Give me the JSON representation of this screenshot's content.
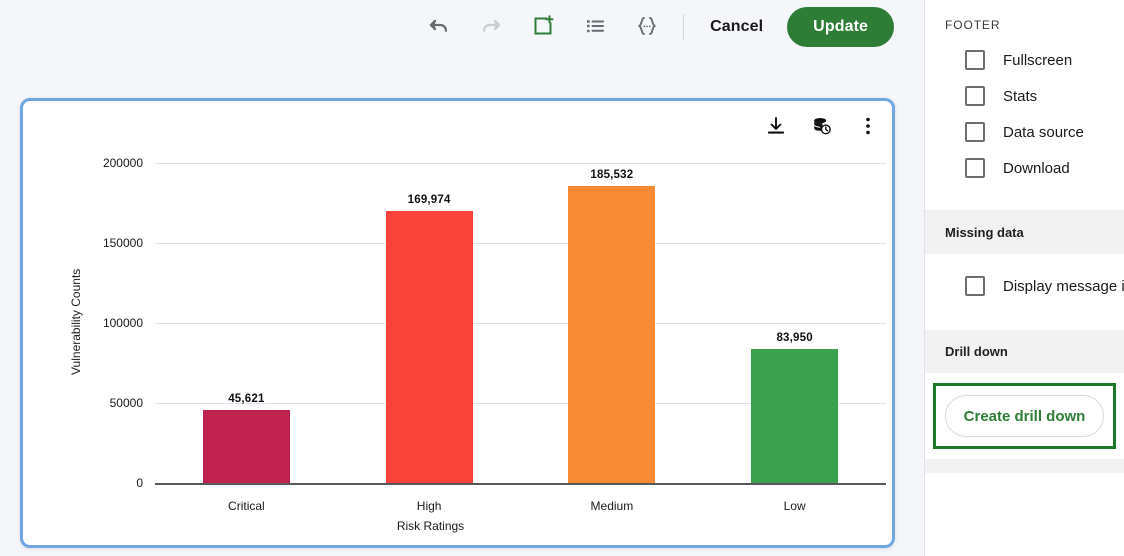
{
  "toolbar": {
    "icons": [
      {
        "name": "undo-icon",
        "label": "Undo",
        "state": "enabled"
      },
      {
        "name": "redo-icon",
        "label": "Redo",
        "state": "disabled"
      },
      {
        "name": "add-widget-icon",
        "label": "Add widget",
        "state": "enabled"
      },
      {
        "name": "legend-list-icon",
        "label": "Legend",
        "state": "enabled"
      },
      {
        "name": "json-braces-icon",
        "label": "JSON",
        "state": "enabled"
      }
    ],
    "cancel_label": "Cancel",
    "update_label": "Update",
    "update_color": "#2E7D36"
  },
  "chart_card": {
    "selected": true,
    "selection_color": "#6FA7E3",
    "actions": [
      {
        "name": "download-icon",
        "label": "Download"
      },
      {
        "name": "data-source-clock-icon",
        "label": "Data source"
      },
      {
        "name": "more-options-icon",
        "label": "More options"
      }
    ]
  },
  "chart_data": {
    "type": "bar",
    "title": "",
    "categories": [
      "Critical",
      "High",
      "Medium",
      "Low"
    ],
    "values": [
      45621,
      169974,
      185532,
      83950
    ],
    "value_labels": [
      "45,621",
      "169,974",
      "185,532",
      "83,950"
    ],
    "colors": [
      "#C0224F",
      "#F8423A",
      "#F78B33",
      "#3CA14E"
    ],
    "xlabel": "Risk Ratings",
    "ylabel": "Vulnerability Counts",
    "ylim": [
      0,
      200000
    ],
    "yticks": [
      0,
      50000,
      100000,
      150000,
      200000
    ],
    "ytick_labels": [
      "0",
      "50000",
      "100000",
      "150000",
      "200000"
    ],
    "grid": true,
    "legend": false,
    "gridline_color": "#DCE3F0",
    "axis_color": "#59595C"
  },
  "sidebar": {
    "footer": {
      "title": "FOOTER",
      "options": [
        {
          "label": "Fullscreen",
          "checked": false
        },
        {
          "label": "Stats",
          "checked": false
        },
        {
          "label": "Data source",
          "checked": false
        },
        {
          "label": "Download",
          "checked": false
        }
      ]
    },
    "missing_data": {
      "title": "Missing data",
      "options": [
        {
          "label": "Display message if",
          "checked": false
        }
      ]
    },
    "drill_down": {
      "title": "Drill down",
      "button_label": "Create drill down",
      "button_color": "#2E7D36",
      "highlight_color": "#1B7A28"
    }
  }
}
